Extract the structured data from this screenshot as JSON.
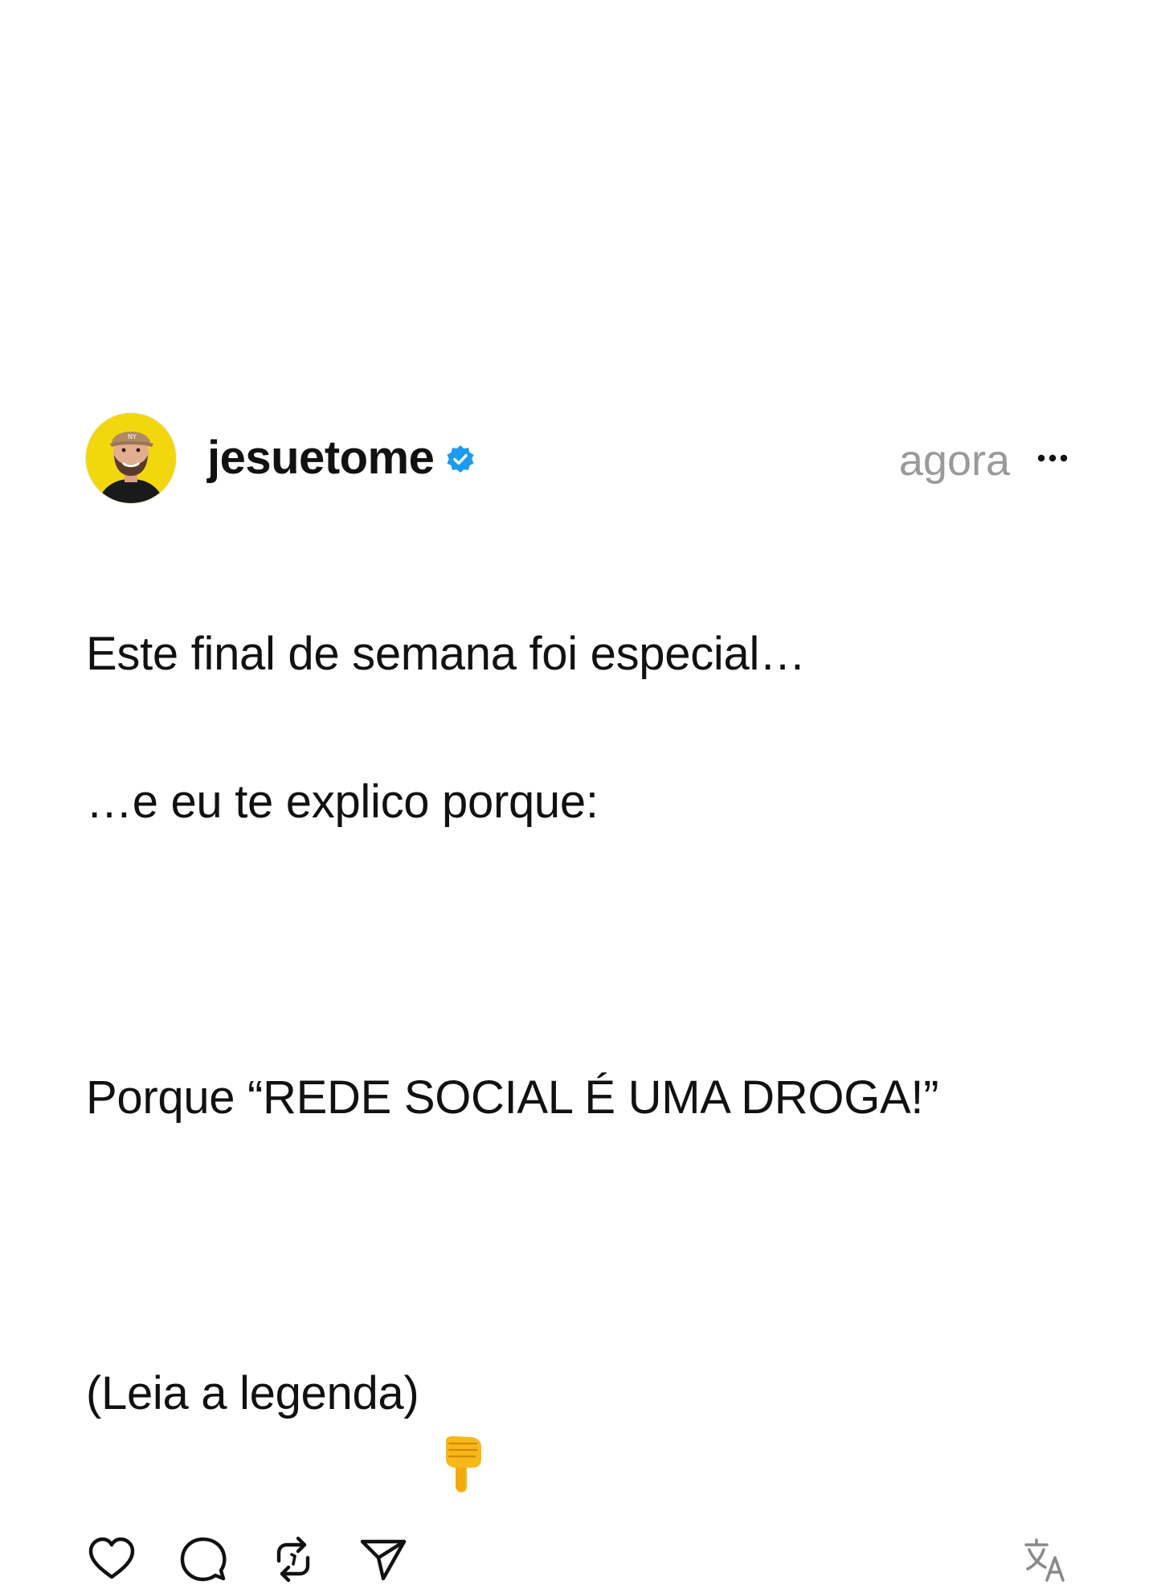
{
  "post": {
    "username": "jesuetome",
    "timestamp": "agora",
    "lines": [
      "Este final de semana foi especial…",
      "…e eu te explico porque:",
      "",
      "Porque “REDE SOCIAL É UMA DROGA!”",
      "",
      "(Leia a legenda)"
    ],
    "emoji": "backhand-index-pointing-down"
  },
  "icons": {
    "verified": "verified-badge-icon",
    "more": "more-options-icon",
    "like": "heart-icon",
    "comment": "comment-icon",
    "repost": "repost-icon",
    "share": "send-icon",
    "translate": "translate-icon"
  },
  "colors": {
    "verified": "#1d9bf0",
    "avatar_bg": "#f2d70e",
    "timestamp": "#9a9a9a",
    "translate_icon": "#8a8a8a"
  }
}
